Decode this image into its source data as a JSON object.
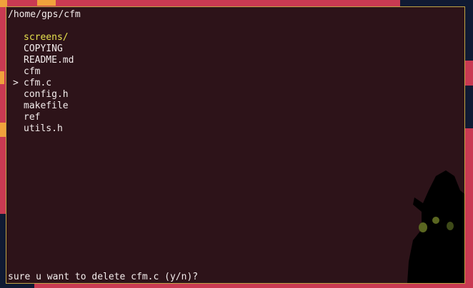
{
  "terminal": {
    "path": "/home/gps/cfm",
    "cursor_glyph": ">",
    "entries": [
      {
        "name": "screens/",
        "is_dir": true,
        "selected": false
      },
      {
        "name": "COPYING",
        "is_dir": false,
        "selected": false
      },
      {
        "name": "README.md",
        "is_dir": false,
        "selected": false
      },
      {
        "name": "cfm",
        "is_dir": false,
        "selected": false
      },
      {
        "name": "cfm.c",
        "is_dir": false,
        "selected": true
      },
      {
        "name": "config.h",
        "is_dir": false,
        "selected": false
      },
      {
        "name": "makefile",
        "is_dir": false,
        "selected": false
      },
      {
        "name": "ref",
        "is_dir": false,
        "selected": false
      },
      {
        "name": "utils.h",
        "is_dir": false,
        "selected": false
      }
    ],
    "prompt": "sure u want to delete cfm.c (y/n)?"
  },
  "colors": {
    "wallpaper": "#c93a52",
    "terminal_bg": "#2d1319",
    "border": "#c2a545",
    "text": "#f3ecec",
    "directory": "#e7e24e"
  }
}
